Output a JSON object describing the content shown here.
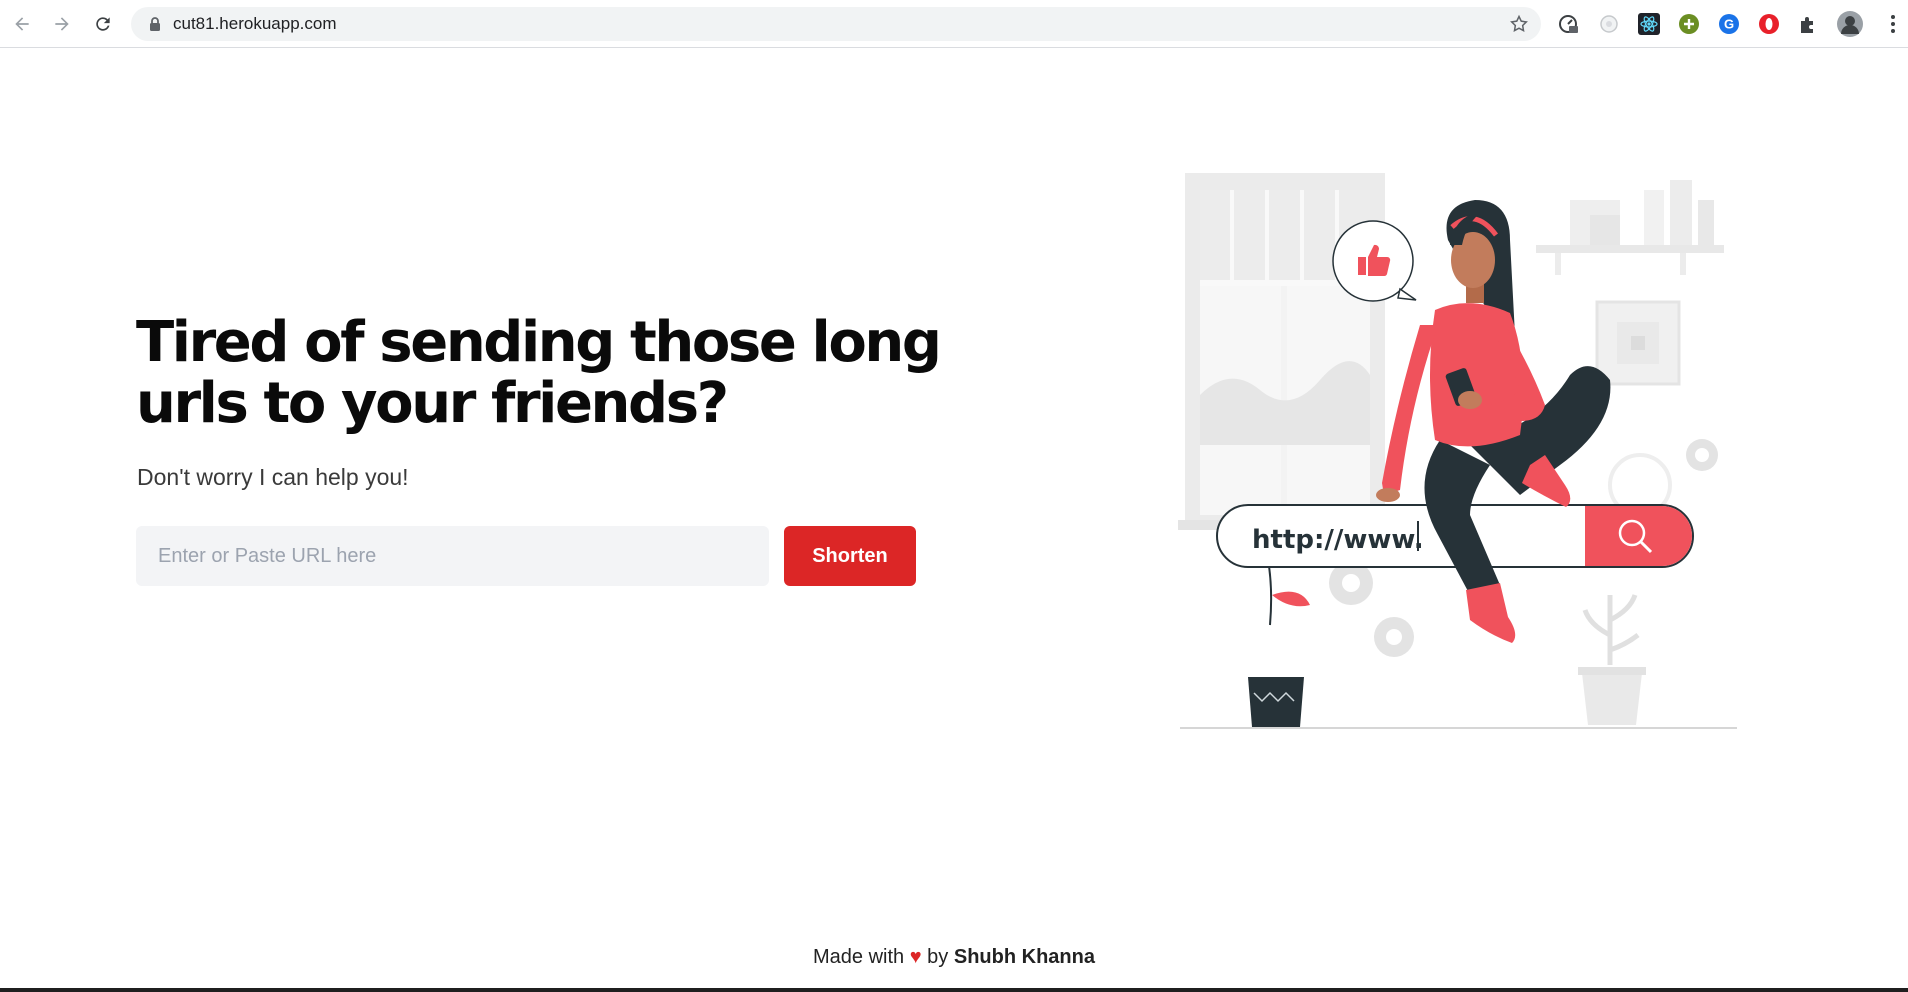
{
  "browser": {
    "url": "cut81.herokuapp.com",
    "icons": {
      "back": "back-arrow-icon",
      "forward": "forward-arrow-icon",
      "reload": "reload-icon",
      "lock": "lock-icon",
      "bookmark": "star-icon",
      "menu": "kebab-menu-icon"
    },
    "extensions": [
      "speed-test-icon",
      "extension-circle-icon",
      "react-devtools-icon",
      "green-plus-icon",
      "google-g-icon",
      "opera-icon",
      "puzzle-icon",
      "profile-avatar-icon"
    ]
  },
  "hero": {
    "title": "Tired of sending those long urls to your friends?",
    "subtitle": "Don't worry I can help you!",
    "input_placeholder": "Enter or Paste URL here",
    "button_label": "Shorten"
  },
  "illustration": {
    "search_text": "http://www."
  },
  "footer": {
    "made_with": "Made with",
    "heart": "♥",
    "by": "by",
    "author": "Shubh Khanna"
  },
  "colors": {
    "accent": "#dc2626",
    "illustration_red": "#f0525c",
    "dark": "#263238",
    "input_bg": "#f3f4f6"
  }
}
